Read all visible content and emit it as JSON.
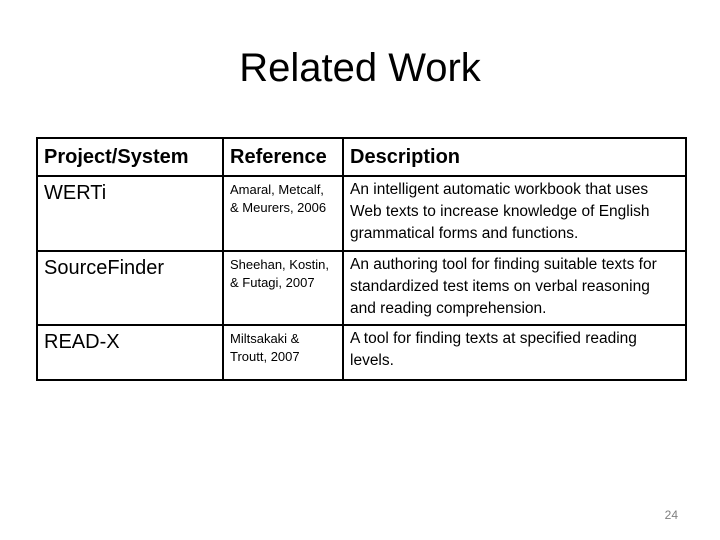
{
  "slide": {
    "title": "Related Work",
    "page_number": "24"
  },
  "table": {
    "headers": [
      "Project/System",
      "Reference",
      "Description"
    ],
    "rows": [
      {
        "project": "WERTi",
        "reference": "Amaral, Metcalf, & Meurers, 2006",
        "description": "An intelligent automatic workbook that uses Web texts to increase knowledge of English grammatical forms and functions."
      },
      {
        "project": "SourceFinder",
        "reference": "Sheehan, Kostin, & Futagi, 2007",
        "description": "An authoring tool for finding suitable texts for standardized test items on verbal reasoning and reading comprehension."
      },
      {
        "project": "READ-X",
        "reference": "Miltsakaki & Troutt, 2007",
        "description": "A tool for finding texts at specified reading levels."
      }
    ]
  }
}
